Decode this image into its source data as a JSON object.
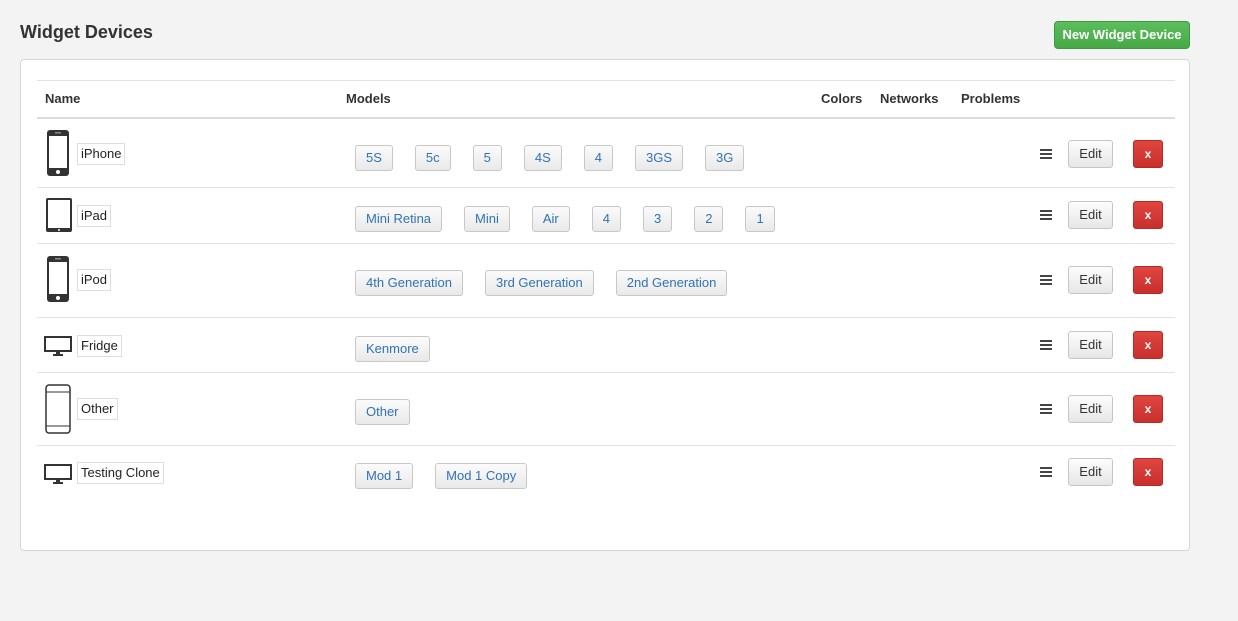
{
  "page": {
    "title": "Widget Devices",
    "new_button": "New Widget Device"
  },
  "table": {
    "headers": {
      "name": "Name",
      "models": "Models",
      "colors": "Colors",
      "networks": "Networks",
      "problems": "Problems"
    },
    "edit_label": "Edit",
    "delete_label": "x",
    "rows": [
      {
        "name": "iPhone",
        "icon": "phone-icon",
        "models": [
          "5S",
          "5c",
          "5",
          "4S",
          "4",
          "3GS",
          "3G"
        ]
      },
      {
        "name": "iPad",
        "icon": "tablet-icon",
        "models": [
          "Mini Retina",
          "Mini",
          "Air",
          "4",
          "3",
          "2",
          "1"
        ]
      },
      {
        "name": "iPod",
        "icon": "phone-icon",
        "models": [
          "4th Generation",
          "3rd Generation",
          "2nd Generation"
        ]
      },
      {
        "name": "Fridge",
        "icon": "monitor-icon",
        "models": [
          "Kenmore"
        ]
      },
      {
        "name": "Other",
        "icon": "generic-phone-icon",
        "models": [
          "Other"
        ]
      },
      {
        "name": "Testing Clone",
        "icon": "monitor-icon",
        "models": [
          "Mod 1",
          "Mod 1 Copy"
        ]
      }
    ]
  },
  "colors": {
    "accent_green": "#4cae4c",
    "danger_red": "#d9534f",
    "link_blue": "#3173b4"
  }
}
